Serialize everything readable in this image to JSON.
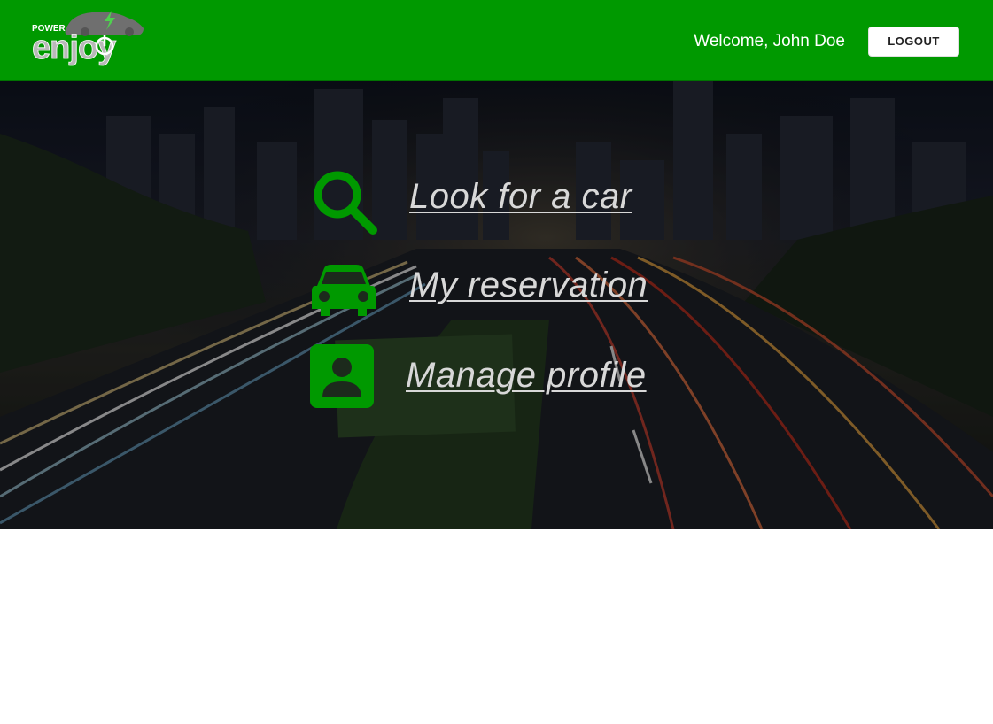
{
  "header": {
    "logo_text_small": "POWER",
    "logo_text_big": "enjoy",
    "welcome_text": "Welcome, John Doe",
    "logout_label": "LOGOUT"
  },
  "menu": {
    "items": [
      {
        "label": "Look for a car",
        "icon": "search-icon"
      },
      {
        "label": "My reservation",
        "icon": "car-icon"
      },
      {
        "label": "Manage profile",
        "icon": "profile-icon"
      }
    ]
  },
  "colors": {
    "header_bg": "#009900",
    "icon_green": "#009900",
    "link_text": "#d8d8d8",
    "page_bg": "#ffffff"
  }
}
